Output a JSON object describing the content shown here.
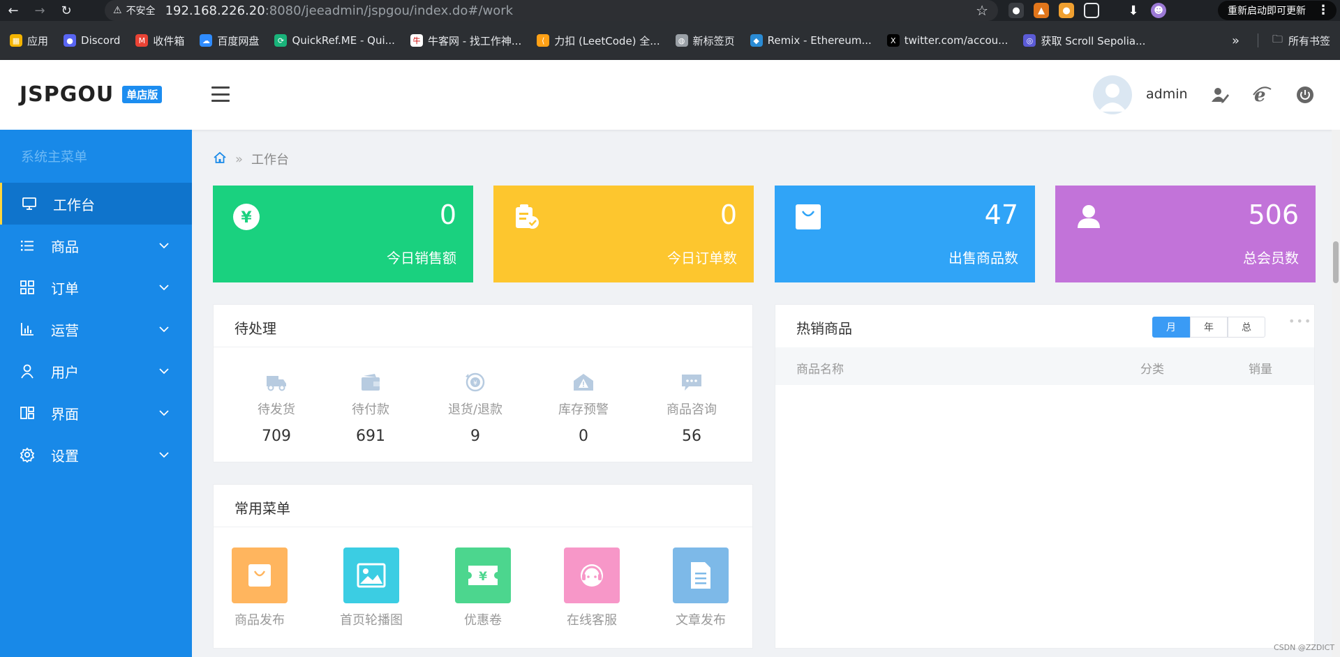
{
  "browser": {
    "insecure_label": "不安全",
    "url_host": "192.168.226.20",
    "url_rest": ":8080/jeeadmin/jspgou/index.do#/work",
    "restart_label": "重新启动即可更新",
    "bookmarks": [
      {
        "label": "应用",
        "icon": "apps-grid-icon",
        "color": "#f4b400"
      },
      {
        "label": "Discord",
        "icon": "discord-icon",
        "color": "#5865f2"
      },
      {
        "label": "收件箱",
        "icon": "gmail-icon",
        "color": "#ea4335"
      },
      {
        "label": "百度网盘",
        "icon": "baidu-netdisk-icon",
        "color": "#2f8cff"
      },
      {
        "label": "QuickRef.ME - Qui...",
        "icon": "quickref-icon",
        "color": "#19b37a"
      },
      {
        "label": "牛客网 - 找工作神...",
        "icon": "nowcoder-icon",
        "color": "#ffffff"
      },
      {
        "label": "力扣 (LeetCode) 全...",
        "icon": "leetcode-icon",
        "color": "#ffa116"
      },
      {
        "label": "新标签页",
        "icon": "globe-icon",
        "color": "#9aa0a6"
      },
      {
        "label": "Remix - Ethereum...",
        "icon": "remix-icon",
        "color": "#2a8bd4"
      },
      {
        "label": "twitter.com/accou...",
        "icon": "x-twitter-icon",
        "color": "#000000"
      },
      {
        "label": "获取 Scroll Sepolia...",
        "icon": "scroll-icon",
        "color": "#5b5bd6"
      }
    ],
    "all_bookmarks_label": "所有书签"
  },
  "header": {
    "logo_text": "JSPGOU",
    "logo_badge": "单店版",
    "username": "admin"
  },
  "sidebar": {
    "title": "系统主菜单",
    "items": [
      {
        "label": "工作台",
        "icon": "monitor-icon",
        "active": true
      },
      {
        "label": "商品",
        "icon": "list-icon"
      },
      {
        "label": "订单",
        "icon": "grid-icon"
      },
      {
        "label": "运营",
        "icon": "bar-chart-icon"
      },
      {
        "label": "用户",
        "icon": "user-icon"
      },
      {
        "label": "界面",
        "icon": "layout-icon"
      },
      {
        "label": "设置",
        "icon": "gear-icon"
      }
    ]
  },
  "breadcrumb": {
    "current": "工作台"
  },
  "stats": [
    {
      "value": "0",
      "label": "今日销售额",
      "color": "#1ad17f",
      "icon": "yuan-icon"
    },
    {
      "value": "0",
      "label": "今日订单数",
      "color": "#fdc62e",
      "icon": "clipboard-check-icon"
    },
    {
      "value": "47",
      "label": "出售商品数",
      "color": "#30a4f7",
      "icon": "shopping-bag-icon"
    },
    {
      "value": "506",
      "label": "总会员数",
      "color": "#c273d9",
      "icon": "member-icon"
    }
  ],
  "pending": {
    "title": "待处理",
    "items": [
      {
        "label": "待发货",
        "value": "709",
        "icon": "truck-icon"
      },
      {
        "label": "待付款",
        "value": "691",
        "icon": "wallet-icon"
      },
      {
        "label": "退货/退款",
        "value": "9",
        "icon": "refund-icon"
      },
      {
        "label": "库存预警",
        "value": "0",
        "icon": "warehouse-warning-icon"
      },
      {
        "label": "商品咨询",
        "value": "56",
        "icon": "chat-icon"
      }
    ]
  },
  "common_menu": {
    "title": "常用菜单",
    "items": [
      {
        "label": "商品发布",
        "color": "#ffb55e",
        "icon": "bag-icon"
      },
      {
        "label": "首页轮播图",
        "color": "#3bcde3",
        "icon": "image-icon"
      },
      {
        "label": "优惠卷",
        "color": "#4cd68e",
        "icon": "coupon-icon"
      },
      {
        "label": "在线客服",
        "color": "#f797c8",
        "icon": "headset-icon"
      },
      {
        "label": "文章发布",
        "color": "#7db9e8",
        "icon": "document-icon"
      }
    ]
  },
  "hot_products": {
    "title": "热销商品",
    "tabs": [
      "月",
      "年",
      "总"
    ],
    "columns": [
      "商品名称",
      "分类",
      "销量"
    ]
  },
  "watermark": "CSDN @ZZDICT"
}
